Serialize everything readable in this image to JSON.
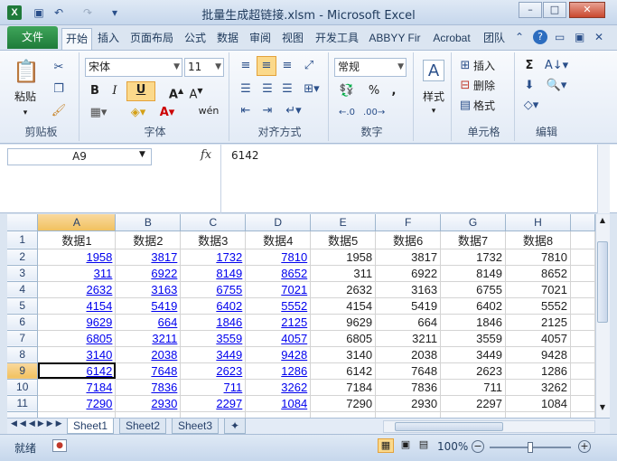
{
  "window": {
    "title": "批量生成超链接.xlsm - Microsoft Excel"
  },
  "ribbon_tabs": [
    "开始",
    "插入",
    "页面布局",
    "公式",
    "数据",
    "审阅",
    "视图",
    "开发工具",
    "ABBYY Fir",
    "Acrobat",
    "团队"
  ],
  "file_tab": "文件",
  "clipboard": {
    "paste": "粘贴",
    "label": "剪贴板"
  },
  "font": {
    "name": "宋体",
    "size": "11",
    "label": "字体",
    "bold": "B",
    "italic": "I",
    "underline": "U",
    "wen": "wén"
  },
  "alignment": {
    "label": "对齐方式"
  },
  "number": {
    "format": "常规",
    "label": "数字",
    "percent": "%",
    "comma": ","
  },
  "styles": {
    "label": "样式"
  },
  "cells": {
    "insert": "插入",
    "delete": "删除",
    "format": "格式",
    "label": "单元格"
  },
  "editing": {
    "label": "编辑",
    "sigma": "Σ"
  },
  "formula_bar": {
    "name_box": "A9",
    "fx": "fx",
    "value": "6142"
  },
  "columns": [
    "A",
    "B",
    "C",
    "D",
    "E",
    "F",
    "G",
    "H"
  ],
  "headers": [
    "数据1",
    "数据2",
    "数据3",
    "数据4",
    "数据5",
    "数据6",
    "数据7",
    "数据8"
  ],
  "rows": [
    [
      1958,
      3817,
      1732,
      7810,
      1958,
      3817,
      1732,
      7810
    ],
    [
      311,
      6922,
      8149,
      8652,
      311,
      6922,
      8149,
      8652
    ],
    [
      2632,
      3163,
      6755,
      7021,
      2632,
      3163,
      6755,
      7021
    ],
    [
      4154,
      5419,
      6402,
      5552,
      4154,
      5419,
      6402,
      5552
    ],
    [
      9629,
      664,
      1846,
      2125,
      9629,
      664,
      1846,
      2125
    ],
    [
      6805,
      3211,
      3559,
      4057,
      6805,
      3211,
      3559,
      4057
    ],
    [
      3140,
      2038,
      3449,
      9428,
      3140,
      2038,
      3449,
      9428
    ],
    [
      6142,
      7648,
      2623,
      1286,
      6142,
      7648,
      2623,
      1286
    ],
    [
      7184,
      7836,
      711,
      3262,
      7184,
      7836,
      711,
      3262
    ],
    [
      7290,
      2930,
      2297,
      1084,
      7290,
      2930,
      2297,
      1084
    ]
  ],
  "row_numbers": [
    "1",
    "2",
    "3",
    "4",
    "5",
    "6",
    "7",
    "8",
    "9",
    "10",
    "11"
  ],
  "sheets": [
    "Sheet1",
    "Sheet2",
    "Sheet3"
  ],
  "status": {
    "ready": "就绪",
    "zoom": "100%"
  }
}
